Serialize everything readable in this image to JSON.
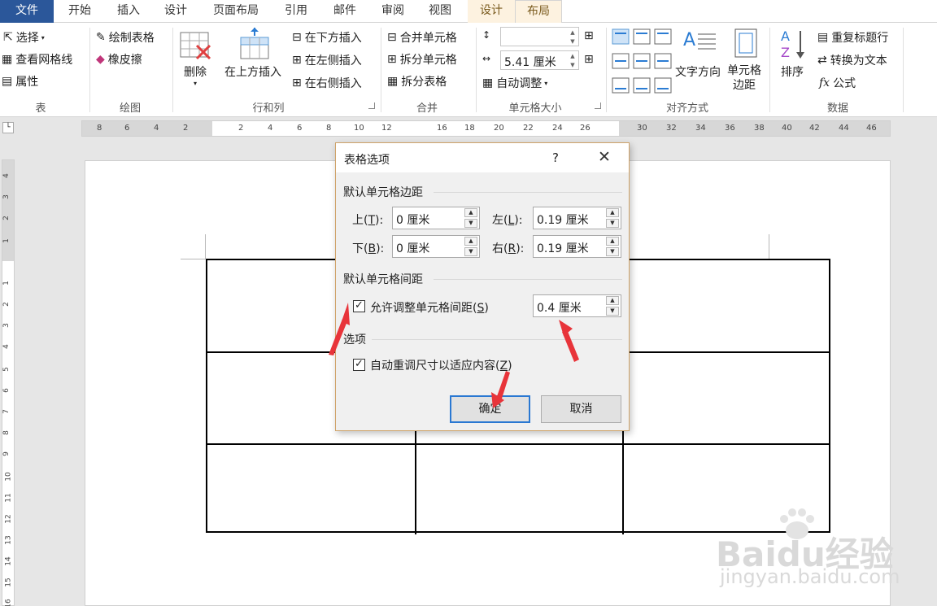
{
  "tabs": {
    "file": "文件",
    "home": "开始",
    "insert": "插入",
    "design1": "设计",
    "layout_page": "页面布局",
    "references": "引用",
    "mailings": "邮件",
    "review": "审阅",
    "view": "视图",
    "design2": "设计",
    "layout": "布局"
  },
  "ribbon": {
    "table": {
      "select": "选择",
      "gridlines": "查看网格线",
      "properties": "属性",
      "label": "表"
    },
    "draw": {
      "draw_table": "绘制表格",
      "eraser": "橡皮擦",
      "label": "绘图"
    },
    "rows_cols": {
      "delete": "删除",
      "insert_above": "在上方插入",
      "insert_below": "在下方插入",
      "insert_left": "在左侧插入",
      "insert_right": "在右侧插入",
      "label": "行和列"
    },
    "merge": {
      "merge_cells": "合并单元格",
      "split_cells": "拆分单元格",
      "split_table": "拆分表格",
      "label": "合并"
    },
    "cell_size": {
      "height_value": "",
      "width_value": "5.41 厘米",
      "autofit": "自动调整",
      "label": "单元格大小"
    },
    "alignment": {
      "text_direction": "文字方向",
      "cell_margins_1": "单元格",
      "cell_margins_2": "边距",
      "label": "对齐方式"
    },
    "data": {
      "sort": "排序",
      "repeat_header": "重复标题行",
      "convert_text": "转换为文本",
      "formula": "公式",
      "label": "数据"
    }
  },
  "hruler_numbers": [
    "8",
    "6",
    "4",
    "2",
    "2",
    "4",
    "6",
    "8",
    "10",
    "12",
    "16",
    "18",
    "20",
    "22",
    "24",
    "26",
    "30",
    "32",
    "34",
    "36",
    "38",
    "40",
    "42",
    "44",
    "46"
  ],
  "vruler_numbers": [
    "4",
    "3",
    "2",
    "1",
    "1",
    "2",
    "3",
    "4",
    "5",
    "6",
    "7",
    "8",
    "9",
    "10",
    "11",
    "12",
    "13",
    "14",
    "15",
    "16"
  ],
  "dialog": {
    "title": "表格选项",
    "help": "?",
    "close": "✕",
    "margins_section": "默认单元格边距",
    "top_label": "上(",
    "top_key": "T",
    "label_end": "):",
    "top_value": "0 厘米",
    "left_label": "左(",
    "left_key": "L",
    "left_value": "0.19 厘米",
    "bottom_label": "下(",
    "bottom_key": "B",
    "bottom_value": "0 厘米",
    "right_label": "右(",
    "right_key": "R",
    "right_value": "0.19 厘米",
    "spacing_section": "默认单元格间距",
    "allow_spacing_label": "允许调整单元格间距(",
    "allow_spacing_key": "S",
    "close_paren": ")",
    "allow_spacing_checked": true,
    "spacing_value": "0.4 厘米",
    "options_section": "选项",
    "autoresize_label": "自动重调尺寸以适应内容(",
    "autoresize_key": "Z",
    "autoresize_checked": true,
    "ok": "确定",
    "cancel": "取消"
  },
  "watermark": {
    "brand": "Baidu经验",
    "url": "jingyan.baidu.com"
  },
  "colors": {
    "file_tab": "#2b579a",
    "context_tab": "#fdf2e0",
    "accent_arrow": "#e8343a",
    "primary_border": "#2a78d2"
  }
}
